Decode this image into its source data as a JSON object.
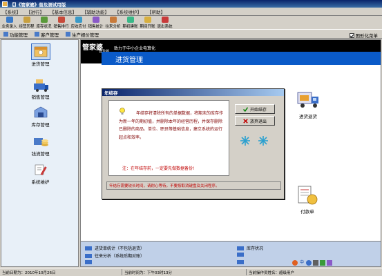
{
  "window": {
    "title": "【】《管家婆》普及测试用版"
  },
  "menu": [
    "【系统】",
    "【进行】",
    "【基本信息】",
    "【辅助功能】",
    "【系统维护】",
    "【帮助】"
  ],
  "toolbar": [
    {
      "label": "业务录入",
      "color": "#3a7ac8"
    },
    {
      "label": "经营历程",
      "color": "#c8a040"
    },
    {
      "label": "库存状况",
      "color": "#5a9a3a"
    },
    {
      "label": "销售排行",
      "color": "#c84a3a"
    },
    {
      "label": "应收应付",
      "color": "#3a9ac8"
    },
    {
      "label": "销售统计",
      "color": "#8a5ac8"
    },
    {
      "label": "往来分析",
      "color": "#c87a3a"
    },
    {
      "label": "期初建账",
      "color": "#3ab888"
    },
    {
      "label": "期间开账",
      "color": "#d8b040"
    },
    {
      "label": "退出系统",
      "color": "#c83a3a"
    }
  ],
  "strip": {
    "items": [
      "功能管理",
      "客户管理",
      "生产报价管理"
    ],
    "checkbox": "图形化菜单"
  },
  "sidebar": [
    {
      "label": "进货管理",
      "selected": true
    },
    {
      "label": "销售管理",
      "selected": false
    },
    {
      "label": "库存管理",
      "selected": false
    },
    {
      "label": "钱流管理",
      "selected": false
    },
    {
      "label": "系统维护",
      "selected": false
    }
  ],
  "banner": {
    "logo": "管家婆",
    "slogan": "致力于中小企业电算化",
    "sub": "普及版",
    "module": "进货管理"
  },
  "right_icons": {
    "arrive": "进货退货",
    "bill": "付款单"
  },
  "dialog": {
    "title": "年结存",
    "paragraph": "年结存将清除所有的单据数据，将期末的库存作为新一年的期初值，并删除本年的经营历程，并保存删除已删除的商品、单位、职员等基础信息，建立系统的运行起点和效率。",
    "note": "注：在年结存前，一定要先做数据备份!",
    "status": "年结存需要较长时间，请耐心等待，不要按取消键盘及关闭程序。",
    "start_button": "开始结存",
    "exit_button": "放弃退出"
  },
  "bottom_links": [
    "进货单统计（不包括退货）",
    "往来分析（系统后期对账）",
    "库存状况"
  ],
  "statusbar": {
    "date": "当前日期为：2010年10月26日",
    "time": "当前时间为：下午03时13分",
    "user": "当前操作员姓名：超级用户"
  }
}
